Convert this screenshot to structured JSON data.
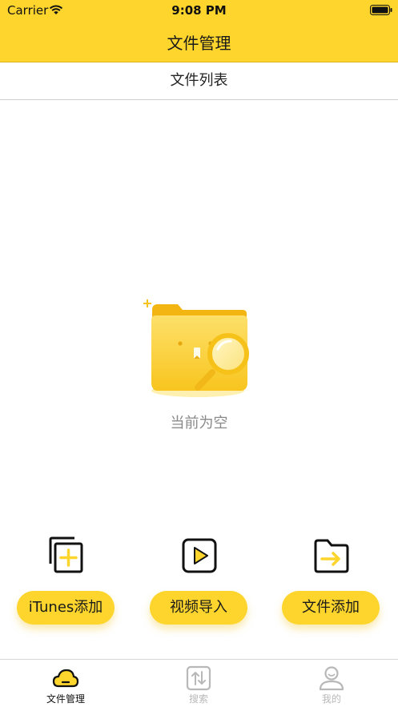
{
  "status_bar": {
    "carrier": "Carrier",
    "time": "9:08 PM"
  },
  "header": {
    "title": "文件管理"
  },
  "section": {
    "title": "文件列表"
  },
  "empty_state": {
    "message": "当前为空",
    "icon": "empty-folder-search-icon"
  },
  "actions": [
    {
      "label": "iTunes添加",
      "icon": "copy-add-icon"
    },
    {
      "label": "视频导入",
      "icon": "video-play-icon"
    },
    {
      "label": "文件添加",
      "icon": "folder-import-icon"
    }
  ],
  "tabbar": {
    "items": [
      {
        "label": "文件管理",
        "icon": "cloud-icon",
        "active": true
      },
      {
        "label": "搜索",
        "icon": "transfer-arrows-icon",
        "active": false
      },
      {
        "label": "我的",
        "icon": "user-icon",
        "active": false
      }
    ]
  },
  "colors": {
    "accent": "#FDD52C",
    "text": "#1a1a1a",
    "muted": "#8a8a8a",
    "inactive": "#b8b8b8"
  }
}
